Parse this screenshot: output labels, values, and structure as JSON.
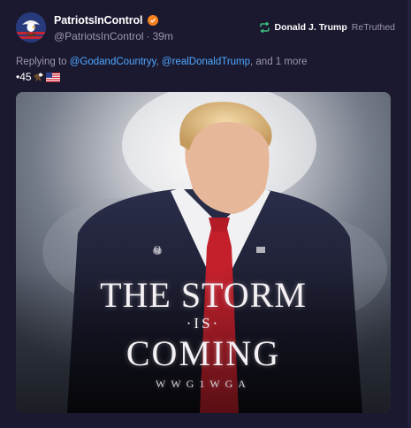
{
  "post": {
    "author": {
      "display_name": "PatriotsInControl",
      "handle": "@PatriotsInControl",
      "separator": "·",
      "time_ago": "39m",
      "verified_badge_color": "#f5821f",
      "avatar_icon": "eagle-flag-avatar"
    },
    "retruth": {
      "icon": "retruth-icon",
      "icon_color": "#3fbf7f",
      "user": "Donald J. Trump",
      "label": "ReTruthed"
    },
    "replying": {
      "prefix": "Replying to",
      "mention1": "@GodandCountryy",
      "comma": ",",
      "mention2": "@realDonaldTrump",
      "suffix": ", and 1 more"
    },
    "body": {
      "text": "•45",
      "emojis": [
        "eagle-emoji",
        "us-flag-emoji"
      ]
    },
    "media": {
      "poster_line1": "THE STORM",
      "poster_line2": "·IS·",
      "poster_line3": "COMING",
      "poster_line4": "WWG1WGA",
      "lapel_letter": "Q"
    }
  },
  "colors": {
    "background": "#1b1930",
    "mention": "#4fa8ff",
    "muted": "#9b98ad"
  }
}
